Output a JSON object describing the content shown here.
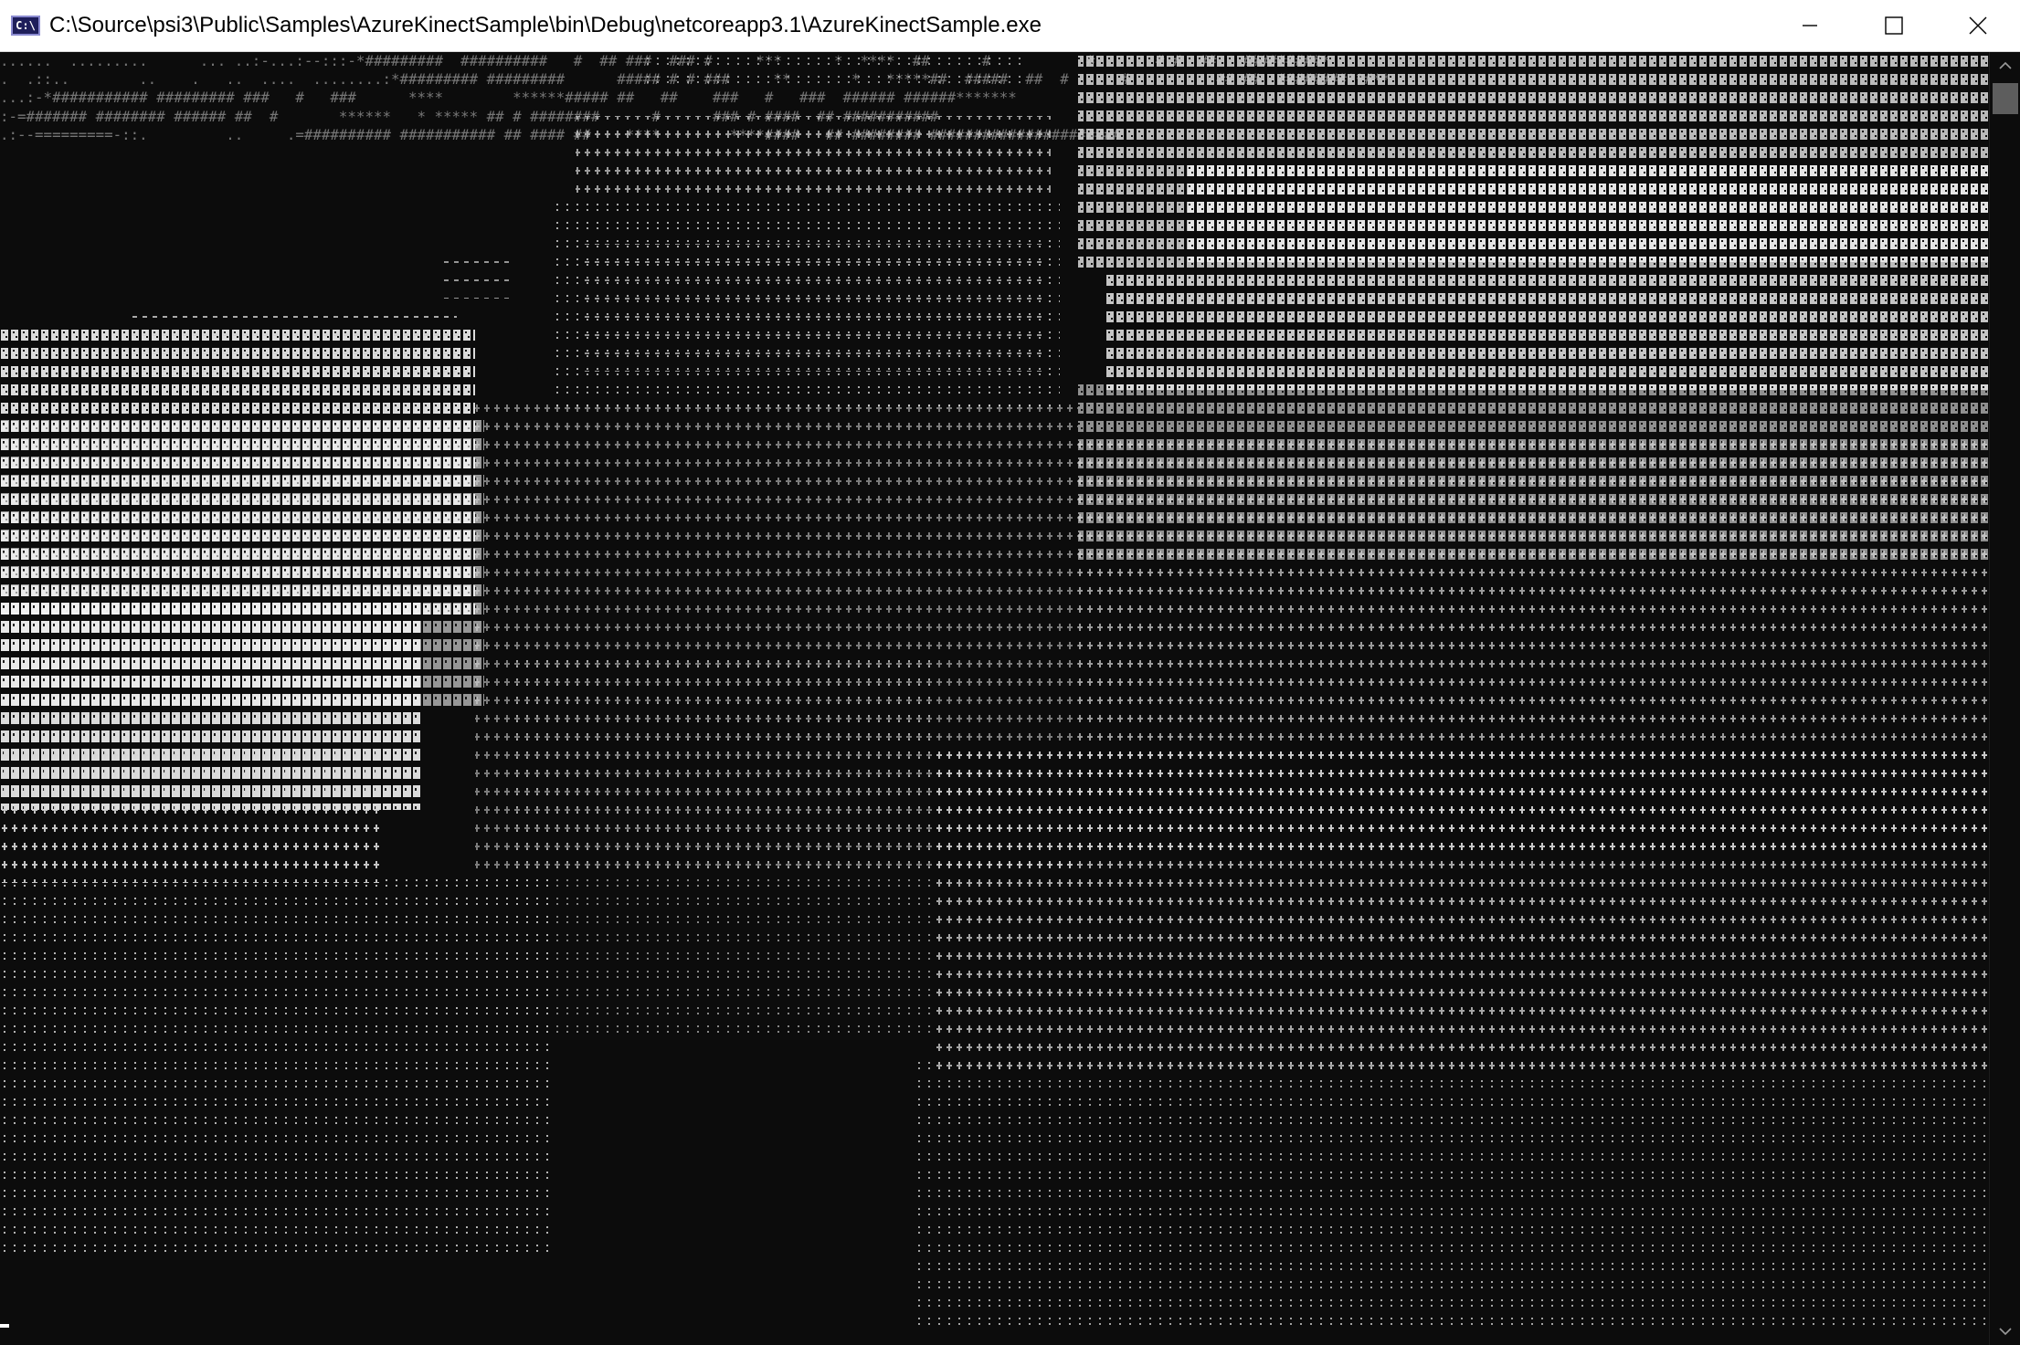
{
  "window": {
    "title": "C:\\Source\\psi3\\Public\\Samples\\AzureKinectSample\\bin\\Debug\\netcoreapp3.1\\AzureKinectSample.exe",
    "icon_text": "C:\\",
    "icon": "console-app-icon",
    "controls": [
      "minimize-icon",
      "maximize-icon",
      "close-icon"
    ]
  },
  "console": {
    "background": "#0c0c0c",
    "foreground": "#cccccc",
    "content_kind": "ascii-art depth rendering",
    "sample_lines": [
      "......  .........      ... ..:-...:--:::-*#########  ##########   #  ## ###  ### #     ***      *  ****  ##      #           #       # #  ##   #########*",
      ".  .::..        ..    .   ..  ....  ........:*######### #########      ##### # # ###     **       *   *****##  #####  ##  #      #          ## ##  ########**#**",
      "...:-*########### ######### ###   #   ###      ****        ******##### ##   ##    ###   #   ###  ###### ######*******",
      ":-=####### ######## ###### ##  #       ******   * ***** ## # ########      #      ### # ####  ## ###########",
      ".:--=========-::.         ..     .=########## ########### ## #### ##    ****        ****####   ## ######## ######################"
    ]
  },
  "scrollbar": {
    "up_icon": "chevron-up-icon",
    "down_icon": "chevron-down-icon"
  }
}
